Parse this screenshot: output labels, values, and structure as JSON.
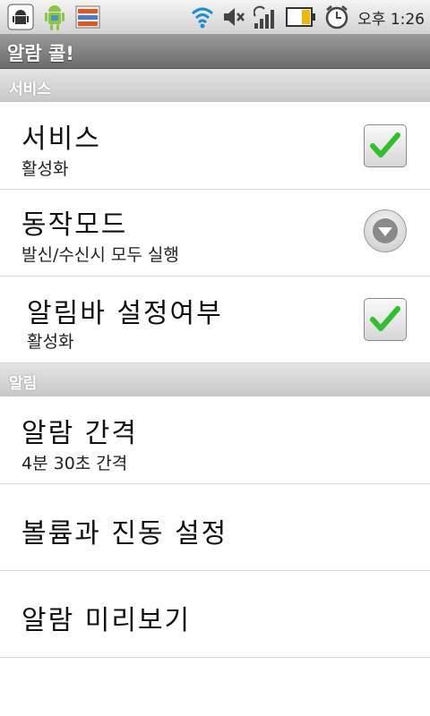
{
  "status_bar": {
    "time": "오후 1:26",
    "icons": [
      "android-debug-icon",
      "android-robot-icon",
      "app-notification-icon",
      "wifi-icon",
      "mute-icon",
      "signal-icon",
      "battery-icon",
      "alarm-clock-icon"
    ],
    "battery_level": 0.4
  },
  "app": {
    "title": "알람 콜!"
  },
  "sections": [
    {
      "header": "서비스",
      "items": [
        {
          "title": "서비스",
          "summary": "활성화",
          "control": "checkbox",
          "checked": true
        },
        {
          "title": "동작모드",
          "summary": "발신/수신시 모두 실행",
          "control": "dropdown"
        },
        {
          "title": "알림바 설정여부",
          "summary": "활성화",
          "control": "checkbox",
          "checked": true
        }
      ]
    },
    {
      "header": "알림",
      "items": [
        {
          "title": "알람 간격",
          "summary": "4분 30초 간격"
        },
        {
          "title": "볼륨과 진동 설정"
        },
        {
          "title": "알람 미리보기"
        }
      ]
    }
  ],
  "colors": {
    "check_green": "#2fbf2f",
    "header_text": "#ffffff",
    "title_bar": "#808080"
  }
}
